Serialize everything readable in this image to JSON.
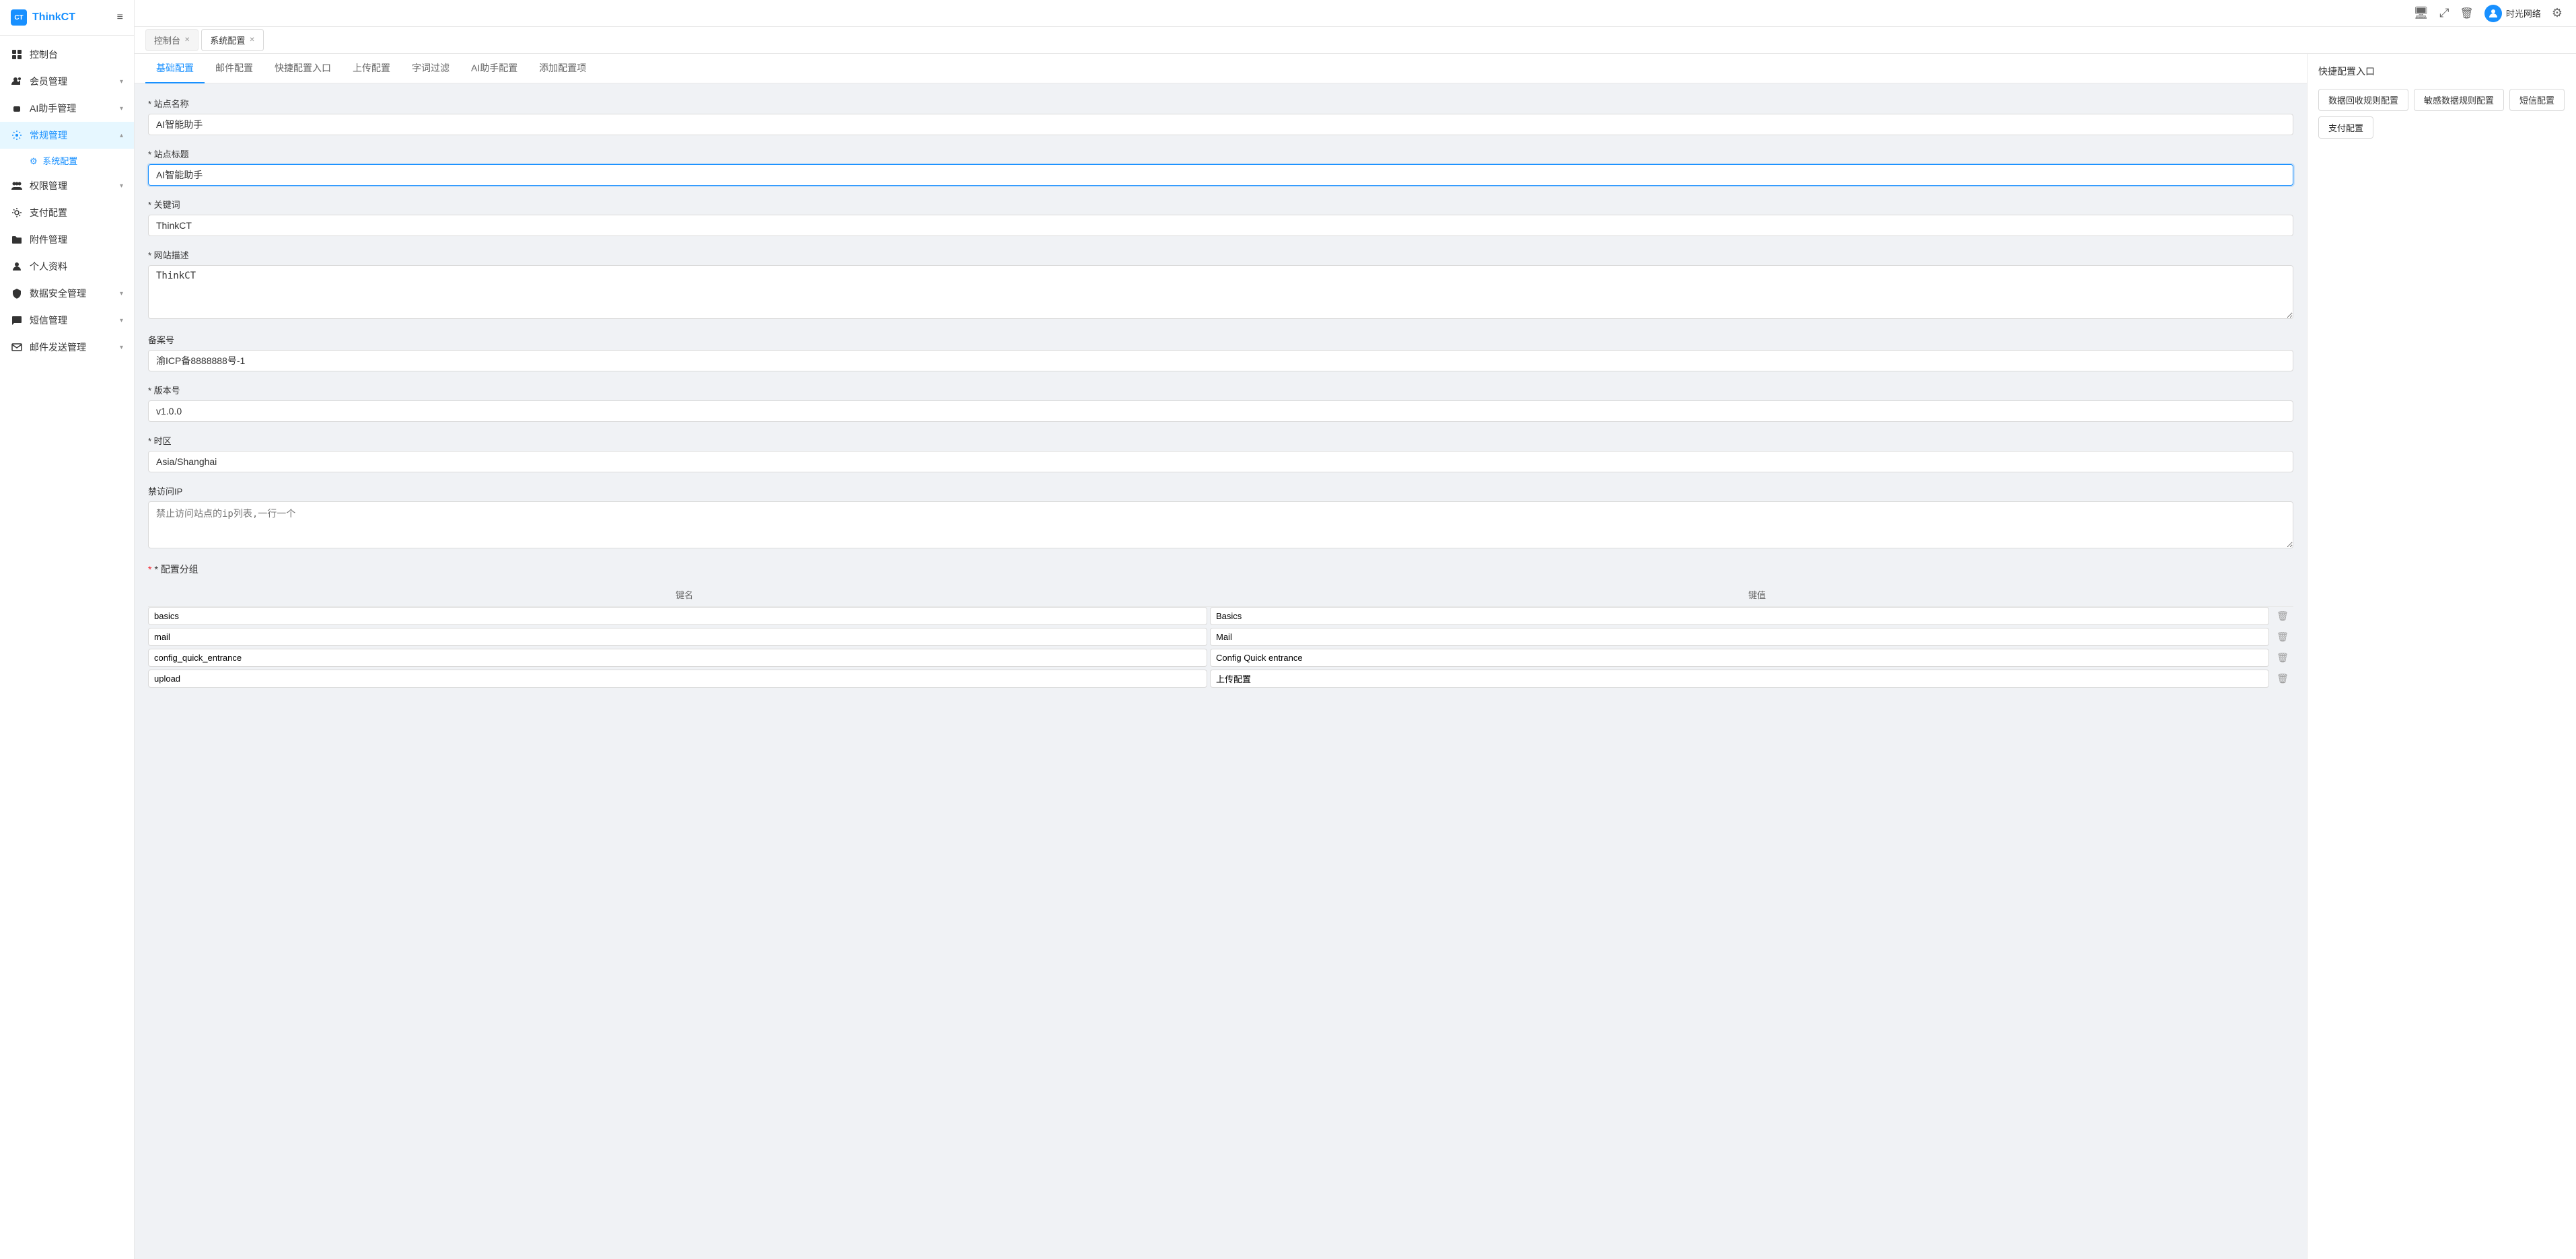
{
  "app": {
    "logo_text": "ThinkCT",
    "logo_icon": "CT"
  },
  "topbar": {
    "monitor_icon": "□",
    "expand_icon": "⤢",
    "delete_icon": "🗑",
    "user_name": "时光网络",
    "settings_icon": "⚙"
  },
  "tabs_bar": {
    "tabs": [
      {
        "label": "控制台",
        "closable": true,
        "active": false
      },
      {
        "label": "系统配置",
        "closable": true,
        "active": true
      }
    ]
  },
  "sidebar": {
    "menu_toggle": "≡",
    "items": [
      {
        "id": "dashboard",
        "label": "控制台",
        "icon": "grid",
        "active": false,
        "expandable": false
      },
      {
        "id": "member",
        "label": "会员管理",
        "icon": "users",
        "active": false,
        "expandable": true
      },
      {
        "id": "ai",
        "label": "AI助手管理",
        "icon": "robot",
        "active": false,
        "expandable": true
      },
      {
        "id": "general",
        "label": "常规管理",
        "icon": "settings2",
        "active": true,
        "expandable": true
      },
      {
        "id": "system-config",
        "label": "系统配置",
        "sub": true,
        "active": true
      },
      {
        "id": "permission",
        "label": "权限管理",
        "icon": "people-group",
        "active": false,
        "expandable": true
      },
      {
        "id": "payment",
        "label": "支付配置",
        "icon": "gear",
        "active": false,
        "expandable": false
      },
      {
        "id": "attachment",
        "label": "附件管理",
        "icon": "folder",
        "active": false,
        "expandable": false
      },
      {
        "id": "profile",
        "label": "个人资料",
        "icon": "person",
        "active": false,
        "expandable": false
      },
      {
        "id": "data-security",
        "label": "数据安全管理",
        "icon": "shield",
        "active": false,
        "expandable": true
      },
      {
        "id": "sms",
        "label": "短信管理",
        "icon": "message",
        "active": false,
        "expandable": true
      },
      {
        "id": "email",
        "label": "邮件发送管理",
        "icon": "mail",
        "active": false,
        "expandable": true
      }
    ]
  },
  "page_tabs": {
    "tabs": [
      {
        "id": "basic",
        "label": "基础配置",
        "active": true
      },
      {
        "id": "mail",
        "label": "邮件配置",
        "active": false
      },
      {
        "id": "quick",
        "label": "快捷配置入口",
        "active": false
      },
      {
        "id": "upload",
        "label": "上传配置",
        "active": false
      },
      {
        "id": "filter",
        "label": "字词过滤",
        "active": false
      },
      {
        "id": "ai-config",
        "label": "AI助手配置",
        "active": false
      },
      {
        "id": "add",
        "label": "添加配置项",
        "active": false
      }
    ]
  },
  "form": {
    "site_name_label": "* 站点名称",
    "site_name_value": "AI智能助手",
    "site_title_label": "* 站点标题",
    "site_title_value": "AI智能助手",
    "keywords_label": "* 关键词",
    "keywords_value": "ThinkCT",
    "description_label": "* 网站描述",
    "description_value": "ThinkCT",
    "icp_label": "备案号",
    "icp_value": "渝ICP备8888888号-1",
    "version_label": "* 版本号",
    "version_value": "v1.0.0",
    "timezone_label": "* 时区",
    "timezone_value": "Asia/Shanghai",
    "blocked_ip_label": "禁访问IP",
    "blocked_ip_placeholder": "禁止访问站点的ip列表,一行一个",
    "blocked_ip_value": "",
    "config_group_label": "* 配置分组",
    "table_key_header": "键名",
    "table_val_header": "键值",
    "rows": [
      {
        "key": "basics",
        "val": "Basics"
      },
      {
        "key": "mail",
        "val": "Mail"
      },
      {
        "key": "config_quick_entrance",
        "val": "Config Quick entrance"
      },
      {
        "key": "upload",
        "val": "上传配置"
      }
    ]
  },
  "right_panel": {
    "title": "快捷配置入口",
    "links": [
      {
        "label": "数据回收规则配置"
      },
      {
        "label": "敏感数据规则配置"
      },
      {
        "label": "短信配置"
      },
      {
        "label": "支付配置"
      }
    ]
  }
}
